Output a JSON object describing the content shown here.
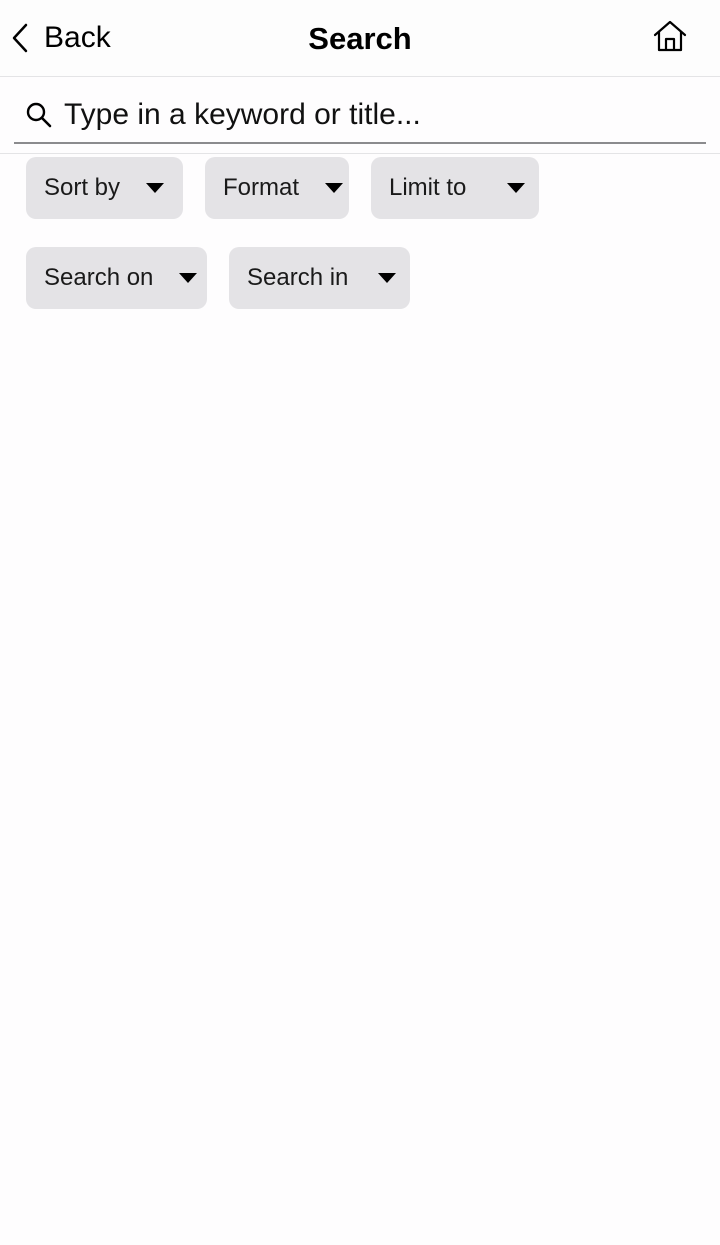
{
  "nav": {
    "back_label": "Back",
    "title": "Search",
    "home_icon": "home-icon"
  },
  "search": {
    "placeholder": "Type in a keyword or title...",
    "value": "",
    "icon": "search-icon"
  },
  "filters": {
    "row1": [
      {
        "label": "Sort by"
      },
      {
        "label": "Format"
      },
      {
        "label": "Limit to"
      }
    ],
    "row2": [
      {
        "label": "Search on"
      },
      {
        "label": "Search in"
      }
    ]
  },
  "colors": {
    "background": "#fefdfe",
    "filter_button_bg": "#e4e3e6",
    "divider": "#e4e4e6",
    "search_underline": "#8b8b8e"
  }
}
